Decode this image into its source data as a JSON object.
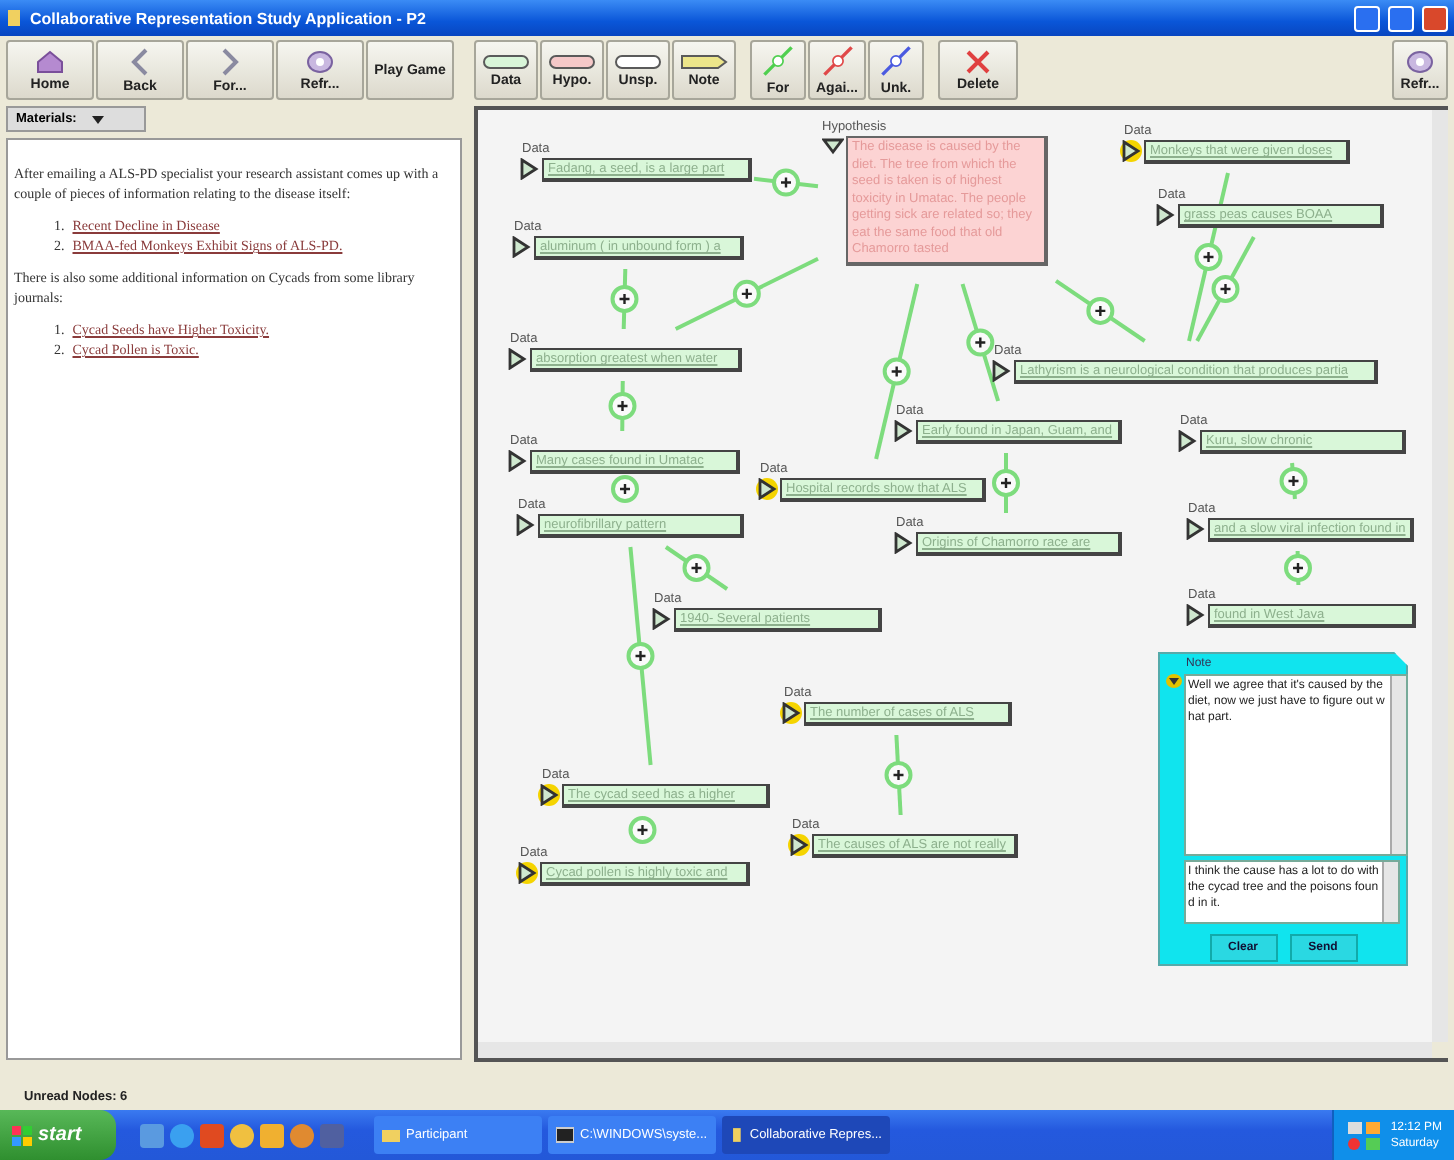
{
  "window": {
    "title": "Collaborative Representation Study Application - P2"
  },
  "left_toolbar": [
    {
      "label": "Home",
      "kind": "home"
    },
    {
      "label": "Back",
      "kind": "back"
    },
    {
      "label": "For...",
      "kind": "forward"
    },
    {
      "label": "Refr...",
      "kind": "refresh"
    },
    {
      "label": "Play Game",
      "kind": "text"
    }
  ],
  "materials": {
    "label": "Materials:"
  },
  "content": [
    {
      "kind": "paragraph",
      "text": "After emailing a ALS-PD specialist your research assistant comes up with a couple of pieces of information relating to the disease itself:"
    },
    {
      "kind": "links",
      "items": [
        {
          "number": "1.",
          "text": "Recent Decline in Disease"
        },
        {
          "number": "2.",
          "text": "BMAA-fed Monkeys Exhibit Signs of ALS-PD."
        }
      ]
    },
    {
      "kind": "paragraph",
      "text": "There is also some additional information on Cycads from some library journals:"
    },
    {
      "kind": "links",
      "items": [
        {
          "number": "1.",
          "text": "Cycad Seeds have Higher Toxicity."
        },
        {
          "number": "2.",
          "text": "Cycad Pollen is Toxic."
        }
      ]
    }
  ],
  "map_toolbar": [
    {
      "label": "Data",
      "kind": "data"
    },
    {
      "label": "Hypo.",
      "kind": "hypothesis"
    },
    {
      "label": "Unsp.",
      "kind": "unspecified"
    },
    {
      "label": "Note",
      "kind": "note"
    },
    {
      "label": "For",
      "kind": "for"
    },
    {
      "label": "Agai...",
      "kind": "against"
    },
    {
      "label": "Unk.",
      "kind": "unknown"
    },
    {
      "label": "Delete",
      "kind": "delete"
    },
    {
      "label": "Refr...",
      "kind": "refresh"
    }
  ],
  "map": {
    "nodes": [
      {
        "kind": "hypothesis",
        "label": "Hypothesis",
        "text": "The disease is caused by the diet. The tree from which the seed is taken is of highest toxicity in Umatac. The people getting sick are related so; they eat the same food that old Chamorro tasted",
        "unread": false
      },
      {
        "kind": "data",
        "label": "Data",
        "text": "Monkeys that were given doses",
        "unread": true
      },
      {
        "kind": "data",
        "label": "Data",
        "text": "Fadang, a seed, is a large part",
        "unread": false
      },
      {
        "kind": "data",
        "label": "Data",
        "text": "grass peas causes BOAA",
        "unread": false
      },
      {
        "kind": "data",
        "label": "Data",
        "text": "aluminum ( in unbound form ) a",
        "unread": false
      },
      {
        "kind": "data",
        "label": "Data",
        "text": "absorption greatest when water",
        "unread": false
      },
      {
        "kind": "data",
        "label": "Data",
        "text": "Lathyrism is a neurological condition that produces partia",
        "unread": false
      },
      {
        "kind": "data",
        "label": "Data",
        "text": "Early found in Japan, Guam, and",
        "unread": false
      },
      {
        "kind": "data",
        "label": "Data",
        "text": "Kuru, slow chronic",
        "unread": false
      },
      {
        "kind": "data",
        "label": "Data",
        "text": "Many cases found in Umatac",
        "unread": false
      },
      {
        "kind": "data",
        "label": "Data",
        "text": "Hospital records show that ALS",
        "unread": true
      },
      {
        "kind": "data",
        "label": "Data",
        "text": "neurofibrillary pattern",
        "unread": false
      },
      {
        "kind": "data",
        "label": "Data",
        "text": "and a slow viral infection found in",
        "unread": false
      },
      {
        "kind": "data",
        "label": "Data",
        "text": "Origins of Chamorro race are",
        "unread": false
      },
      {
        "kind": "data",
        "label": "Data",
        "text": "1940- Several patients",
        "unread": false
      },
      {
        "kind": "data",
        "label": "Data",
        "text": "found in West Java",
        "unread": false
      },
      {
        "kind": "data",
        "label": "Data",
        "text": "The number of cases of ALS",
        "unread": true
      },
      {
        "kind": "data",
        "label": "Data",
        "text": "The cycad seed has a higher",
        "unread": true
      },
      {
        "kind": "data",
        "label": "Data",
        "text": "The causes of ALS are not really",
        "unread": true
      },
      {
        "kind": "data",
        "label": "Data",
        "text": "Cycad pollen is highly toxic and",
        "unread": true
      }
    ],
    "links": [
      {
        "kind": "for"
      },
      {
        "kind": "for"
      },
      {
        "kind": "for"
      },
      {
        "kind": "for"
      },
      {
        "kind": "for"
      },
      {
        "kind": "for"
      },
      {
        "kind": "for"
      },
      {
        "kind": "for"
      },
      {
        "kind": "for"
      },
      {
        "kind": "for"
      },
      {
        "kind": "for"
      },
      {
        "kind": "for"
      },
      {
        "kind": "for"
      },
      {
        "kind": "for"
      },
      {
        "kind": "for"
      },
      {
        "kind": "for"
      },
      {
        "kind": "for"
      }
    ]
  },
  "note": {
    "label": "Note",
    "messages": "Well we agree that it's caused by the diet, now we just have to figure out what part.",
    "draft": "I think the cause has a lot to do with the cycad tree and the poisons found in it.",
    "buttons": [
      "Clear",
      "Send"
    ]
  },
  "status_bar": "Unread Nodes: 6",
  "taskbar": {
    "start": "start",
    "tasks": [
      {
        "label": "Participant",
        "kind": "folder",
        "selected": false
      },
      {
        "label": "C:\\WINDOWS\\syste...",
        "kind": "console",
        "selected": false
      },
      {
        "label": "Collaborative Repres...",
        "kind": "app",
        "selected": true
      }
    ],
    "clock": "12:12 PM",
    "day": "Saturday"
  }
}
